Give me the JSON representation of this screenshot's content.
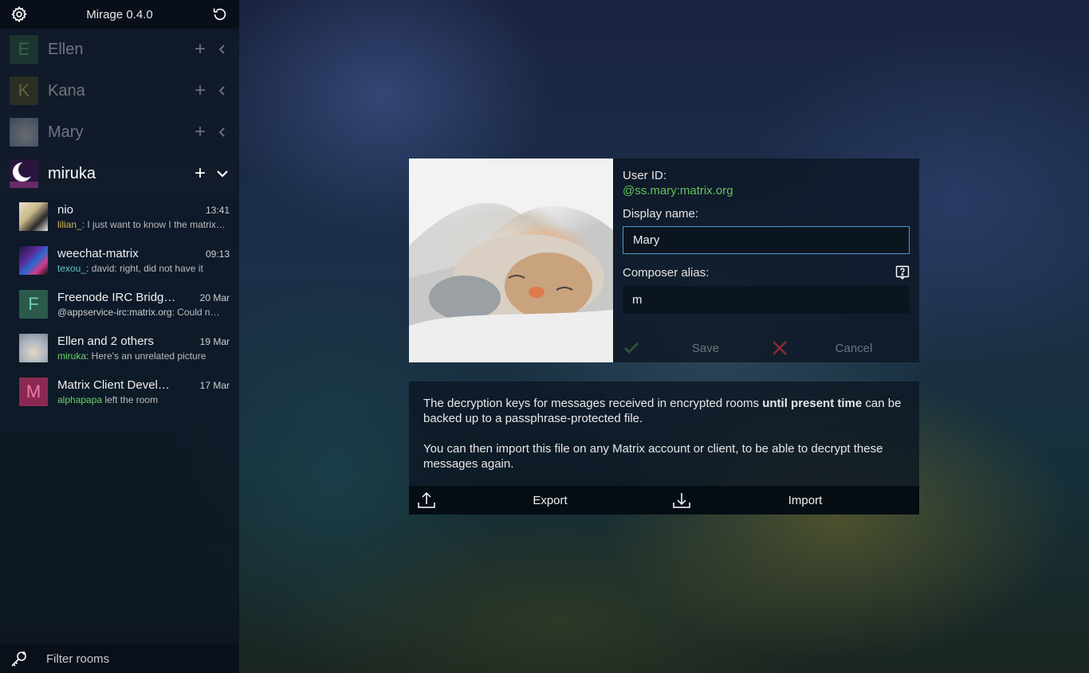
{
  "app": {
    "title": "Mirage 0.4.0"
  },
  "accounts": [
    {
      "name": "Ellen",
      "initial": "E",
      "avatar_color": "#2f5a3a",
      "initial_color": "#6fbf7a"
    },
    {
      "name": "Kana",
      "initial": "K",
      "avatar_color": "#4f4a1d",
      "initial_color": "#c9bd5a"
    },
    {
      "name": "Mary",
      "initial": "",
      "avatar_color": "#8c9aa8"
    }
  ],
  "active_account": {
    "name": "miruka"
  },
  "rooms": [
    {
      "name": "nio",
      "time": "13:41",
      "sender": "lilian_",
      "sender_color": "#d4b65a",
      "message": ": I just want to know I the matrix…"
    },
    {
      "name": "weechat-matrix",
      "time": "09:13",
      "sender": "texou_",
      "sender_color": "#5fc2c4",
      "message": ": david: right, did not have it"
    },
    {
      "name": "Freenode IRC Bridg…",
      "initial": "F",
      "avatar_color": "#2b5a4c",
      "initial_color": "#6ad0b0",
      "time": "20 Mar",
      "sender": "@appservice-irc:matrix.org",
      "sender_color": "#cfcfcf",
      "message": ": Could n…"
    },
    {
      "name": "Ellen and 2 others",
      "time": "19 Mar",
      "sender": "miruka",
      "sender_color": "#6fcf6f",
      "message": ": Here's an unrelated picture"
    },
    {
      "name": "Matrix Client Devel…",
      "initial": "M",
      "avatar_color": "#8a2a52",
      "initial_color": "#f07aa8",
      "time": "17 Mar",
      "sender": "alphapapa",
      "sender_color": "#6fcf6f",
      "message": " left the room"
    }
  ],
  "filter": {
    "placeholder": "Filter rooms"
  },
  "profile": {
    "user_id_label": "User ID:",
    "user_id": "@ss.mary:matrix.org",
    "display_name_label": "Display name:",
    "display_name": "Mary",
    "composer_alias_label": "Composer alias:",
    "composer_alias": "m",
    "save_label": "Save",
    "cancel_label": "Cancel"
  },
  "keys": {
    "text1_before": "The decryption keys for messages received in encrypted rooms ",
    "text1_bold": "until present time",
    "text1_after": " can be backed up to a passphrase-protected file.",
    "text2": "You can then import this file on any Matrix account or client, to be able to decrypt these messages again.",
    "export_label": "Export",
    "import_label": "Import"
  },
  "colors": {
    "accent_green": "#63c45a",
    "focus_border": "#4a9ad0",
    "cancel_red": "#8a2a34",
    "save_green": "#2f5a38"
  }
}
